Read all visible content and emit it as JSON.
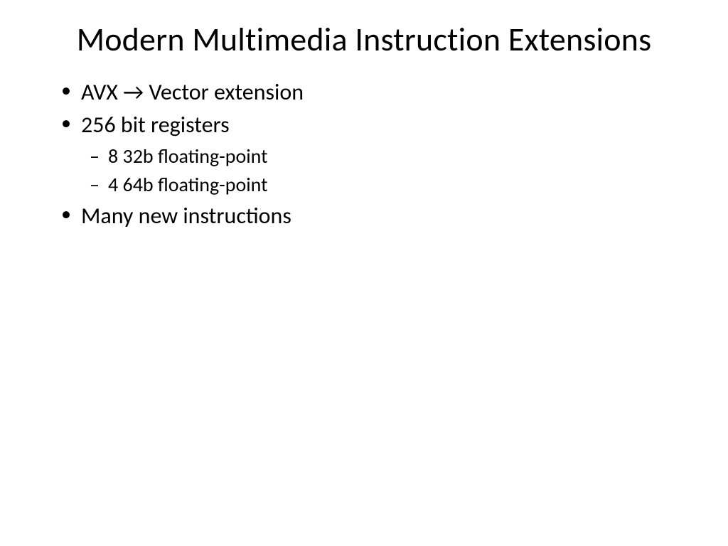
{
  "title": "Modern Multimedia Instruction Extensions",
  "bullets": {
    "b0": "AVX → Vector extension",
    "b1": "256 bit registers",
    "b1_0": "8 32b floating-point",
    "b1_1": "4 64b floating-point",
    "b2": "Many new instructions"
  }
}
